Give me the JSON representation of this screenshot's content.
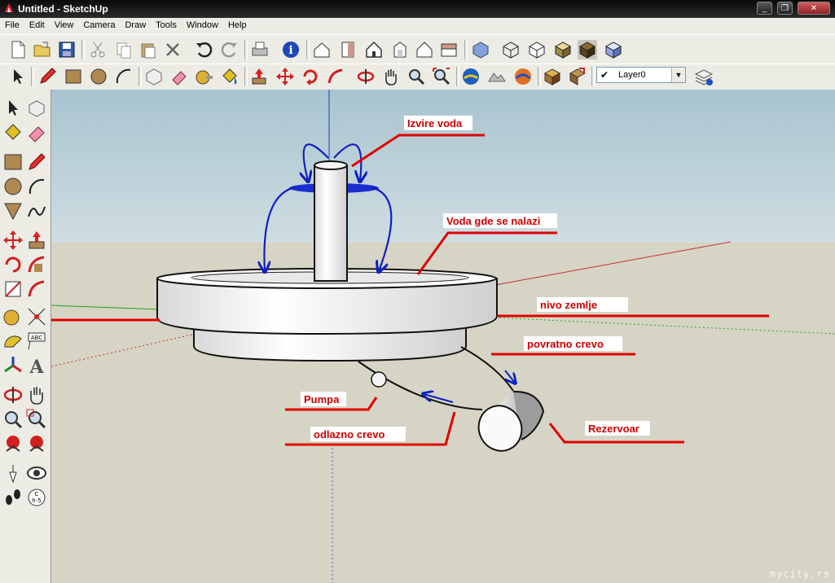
{
  "window": {
    "title": "Untitled - SketchUp",
    "controls": [
      "minimize",
      "restore",
      "close"
    ]
  },
  "menu": [
    "File",
    "Edit",
    "View",
    "Camera",
    "Draw",
    "Tools",
    "Window",
    "Help"
  ],
  "toolbar": {
    "layer_value": "Layer0"
  },
  "scene": {
    "labels": {
      "izvire_voda": "Izvire voda",
      "voda_gde": "Voda gde se nalazi",
      "nivo_zemlje": "nivo zemlje",
      "povratno_crevo": "povratno crevo",
      "pumpa": "Pumpa",
      "odlazno_crevo": "odlazno crevo",
      "rezervoar": "Rezervoar"
    },
    "colors": {
      "sky": "#bcd3dc",
      "ground": "#d6d4c4",
      "label_text": "#cc0000",
      "leader": "#e00000",
      "water_arrows": "#1020c0"
    }
  },
  "watermark": "mycity.rs"
}
